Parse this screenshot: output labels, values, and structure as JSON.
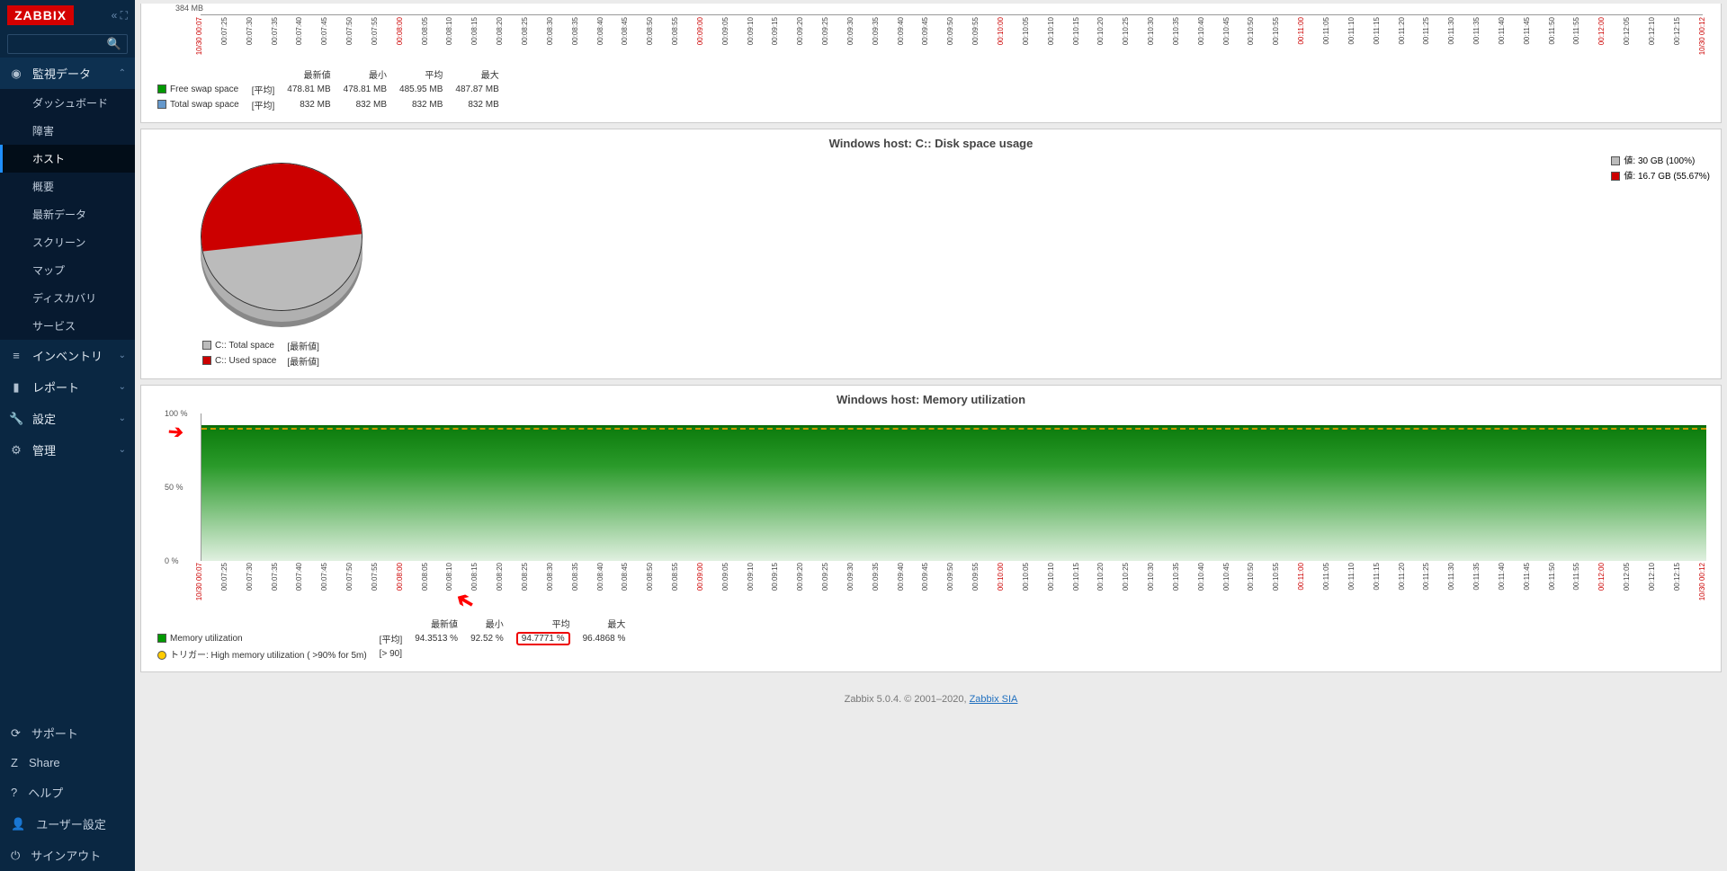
{
  "brand": "ZABBIX",
  "nav": {
    "monitoring": "監視データ",
    "sub": {
      "dashboard": "ダッシュボード",
      "problems": "障害",
      "hosts": "ホスト",
      "overview": "概要",
      "latest": "最新データ",
      "screens": "スクリーン",
      "maps": "マップ",
      "discovery": "ディスカバリ",
      "services": "サービス"
    },
    "inventory": "インベントリ",
    "reports": "レポート",
    "settings": "設定",
    "admin": "管理"
  },
  "bottom": {
    "support": "サポート",
    "share": "Share",
    "help": "ヘルプ",
    "usersettings": "ユーザー設定",
    "signout": "サインアウト"
  },
  "swap": {
    "ylabel": "384 MB",
    "headers": {
      "latest": "最新値",
      "min": "最小",
      "avg": "平均",
      "max": "最大"
    },
    "mode": "[平均]",
    "rows": [
      {
        "name": "Free swap space",
        "latest": "478.81 MB",
        "min": "478.81 MB",
        "avg": "485.95 MB",
        "max": "487.87 MB",
        "color": "#009900"
      },
      {
        "name": "Total swap space",
        "latest": "832 MB",
        "min": "832 MB",
        "avg": "832 MB",
        "max": "832 MB",
        "color": "#6699cc"
      }
    ]
  },
  "disk": {
    "title": "Windows host: C:: Disk space usage",
    "legend": [
      {
        "label": "値: 30 GB (100%)",
        "color": "#bbbbbb"
      },
      {
        "label": "値: 16.7 GB (55.67%)",
        "color": "#cc0000"
      }
    ],
    "meta_mode": "[最新値]",
    "rows": [
      {
        "name": "C:: Total space",
        "color": "#bbbbbb"
      },
      {
        "name": "C:: Used space",
        "color": "#cc0000"
      }
    ]
  },
  "mem": {
    "title": "Windows host: Memory utilization",
    "y": {
      "y100": "100 %",
      "y50": "50 %",
      "y0": "0 %"
    },
    "headers": {
      "latest": "最新値",
      "min": "最小",
      "avg": "平均",
      "max": "最大"
    },
    "mode": "[平均]",
    "row": {
      "name": "Memory utilization",
      "latest": "94.3513 %",
      "min": "92.52 %",
      "avg": "94.7771 %",
      "max": "96.4868 %"
    },
    "trigger_label": "トリガー: High memory utilization ( >90% for 5m)",
    "trigger_val": "[> 90]"
  },
  "xaxis": {
    "start": "10/30 00:07",
    "end": "10/30 00:12",
    "ticks": [
      "00:07:25",
      "00:07:30",
      "00:07:35",
      "00:07:40",
      "00:07:45",
      "00:07:50",
      "00:07:55",
      "00:08:00",
      "00:08:05",
      "00:08:10",
      "00:08:15",
      "00:08:20",
      "00:08:25",
      "00:08:30",
      "00:08:35",
      "00:08:40",
      "00:08:45",
      "00:08:50",
      "00:08:55",
      "00:09:00",
      "00:09:05",
      "00:09:10",
      "00:09:15",
      "00:09:20",
      "00:09:25",
      "00:09:30",
      "00:09:35",
      "00:09:40",
      "00:09:45",
      "00:09:50",
      "00:09:55",
      "00:10:00",
      "00:10:05",
      "00:10:10",
      "00:10:15",
      "00:10:20",
      "00:10:25",
      "00:10:30",
      "00:10:35",
      "00:10:40",
      "00:10:45",
      "00:10:50",
      "00:10:55",
      "00:11:00",
      "00:11:05",
      "00:11:10",
      "00:11:15",
      "00:11:20",
      "00:11:25",
      "00:11:30",
      "00:11:35",
      "00:11:40",
      "00:11:45",
      "00:11:50",
      "00:11:55",
      "00:12:00",
      "00:12:05",
      "00:12:10",
      "00:12:15"
    ],
    "red_ticks": [
      "00:08:00",
      "00:09:00",
      "00:10:00",
      "00:11:00",
      "00:12:00"
    ]
  },
  "footer": {
    "text": "Zabbix 5.0.4. © 2001–2020, ",
    "link": "Zabbix SIA"
  },
  "chart_data": [
    {
      "type": "table",
      "title": "Swap space (partial view)",
      "series": [
        {
          "name": "Free swap space",
          "latest": 478.81,
          "min": 478.81,
          "avg": 485.95,
          "max": 487.87,
          "unit": "MB"
        },
        {
          "name": "Total swap space",
          "latest": 832,
          "min": 832,
          "avg": 832,
          "max": 832,
          "unit": "MB"
        }
      ]
    },
    {
      "type": "pie",
      "title": "Windows host: C:: Disk space usage",
      "categories": [
        "Total space",
        "Used space"
      ],
      "values": [
        30,
        16.7
      ],
      "unit": "GB",
      "percentages": [
        100,
        55.67
      ]
    },
    {
      "type": "area",
      "title": "Windows host: Memory utilization",
      "x_range": [
        "10/30 00:07",
        "10/30 00:12"
      ],
      "ylim": [
        0,
        100
      ],
      "ylabel": "%",
      "series": [
        {
          "name": "Memory utilization",
          "latest": 94.3513,
          "min": 92.52,
          "avg": 94.7771,
          "max": 96.4868
        }
      ],
      "trigger": {
        "name": "High memory utilization ( >90% for 5m)",
        "threshold": 90
      }
    }
  ]
}
